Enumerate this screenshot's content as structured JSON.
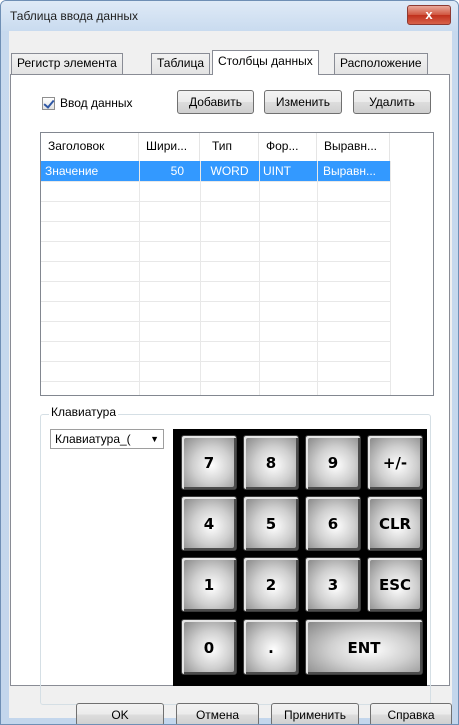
{
  "window": {
    "title": "Таблица ввода данных",
    "close_label": "x"
  },
  "tabs": [
    "Регистр элемента",
    "Таблица",
    "Столбцы данных",
    "Расположение"
  ],
  "toolbar": {
    "checkbox_label": "Ввод данных",
    "checkbox_checked": true,
    "add_label": "Добавить",
    "edit_label": "Изменить",
    "delete_label": "Удалить"
  },
  "list": {
    "columns": [
      "Заголовок",
      "Шири...",
      "Тип",
      "Фор...",
      "Выравн..."
    ],
    "rows": [
      [
        "Значение",
        "50",
        "WORD",
        "UINT",
        "Выравн..."
      ]
    ]
  },
  "keyboard_group": {
    "label": "Клавиатура",
    "selected": "Клавиатура_(",
    "keys": [
      "7",
      "8",
      "9",
      "+/-",
      "4",
      "5",
      "6",
      "CLR",
      "1",
      "2",
      "3",
      "ESC",
      "0",
      ".",
      "ENT"
    ]
  },
  "footer": {
    "ok_label": "OK",
    "cancel_label": "Отмена",
    "apply_label": "Применить",
    "help_label": "Справка"
  },
  "colors": {
    "selection": "#3399ff",
    "title_bar": "#c9dbef",
    "close_button": "#c0301c"
  }
}
